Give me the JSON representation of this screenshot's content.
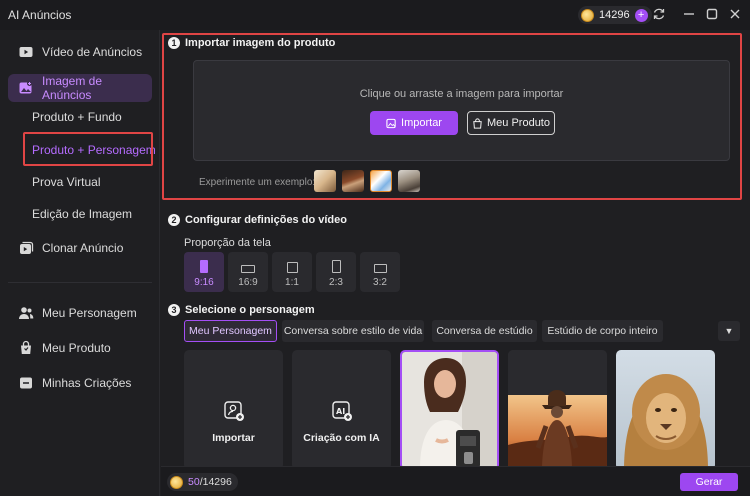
{
  "app": {
    "title": "AI Anúncios",
    "credits": "14296",
    "plus": "+"
  },
  "sidebar": {
    "items": [
      {
        "label": "Vídeo de Anúncios"
      },
      {
        "label": "Imagem de Anúncios"
      },
      {
        "label": "Clonar Anúncio"
      },
      {
        "label": "Meu Personagem"
      },
      {
        "label": "Meu Produto"
      },
      {
        "label": "Minhas Criações"
      }
    ],
    "subitems": [
      {
        "label": "Produto + Fundo"
      },
      {
        "label": "Produto + Personagem"
      },
      {
        "label": "Prova Virtual"
      },
      {
        "label": "Edição de Imagem"
      }
    ]
  },
  "step1": {
    "num": "1",
    "title": "Importar imagem do produto",
    "hint": "Clique ou arraste a imagem para importar",
    "import_label": "Importar",
    "my_product_label": "Meu Produto",
    "example_label": "Experimente um exemplo:"
  },
  "step2": {
    "num": "2",
    "title": "Configurar definições do vídeo",
    "ratio_label": "Proporção da tela",
    "ratios": [
      "9:16",
      "16:9",
      "1:1",
      "2:3",
      "3:2"
    ]
  },
  "step3": {
    "num": "3",
    "title": "Selecione o personagem",
    "chips": [
      "Meu Personagem",
      "Conversa sobre estilo de vida",
      "Conversa de estúdio",
      "Estúdio de corpo inteiro"
    ],
    "cards": {
      "import_label": "Importar",
      "ai_label": "Criação com IA"
    }
  },
  "bottom": {
    "cost_used": "50",
    "cost_total": "/14296",
    "generate_label": "Gerar"
  },
  "colors": {
    "accent": "#9d47f0",
    "highlight": "#e04545"
  }
}
